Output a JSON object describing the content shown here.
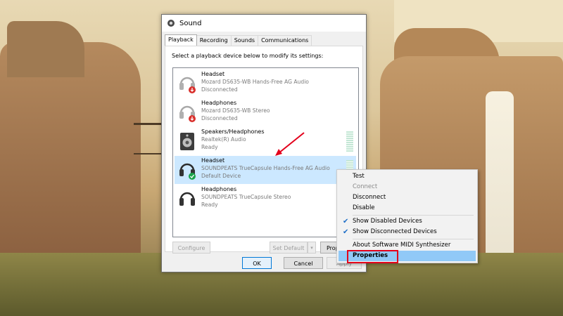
{
  "window": {
    "title": "Sound",
    "tabs": [
      "Playback",
      "Recording",
      "Sounds",
      "Communications"
    ],
    "active_tab": "Playback",
    "instruction": "Select a playback device below to modify its settings:"
  },
  "devices": [
    {
      "name": "Headset",
      "desc": "Mozard DS635-WB Hands-Free AG Audio",
      "status": "Disconnected",
      "icon": "headset-disconnected-icon"
    },
    {
      "name": "Headphones",
      "desc": "Mozard DS635-WB Stereo",
      "status": "Disconnected",
      "icon": "headphones-disconnected-icon"
    },
    {
      "name": "Speakers/Headphones",
      "desc": "Realtek(R) Audio",
      "status": "Ready",
      "icon": "speaker-icon"
    },
    {
      "name": "Headset",
      "desc": "SOUNDPEATS TrueCapsule Hands-Free AG Audio",
      "status": "Default Device",
      "icon": "headset-default-icon"
    },
    {
      "name": "Headphones",
      "desc": "SOUNDPEATS TrueCapsule Stereo",
      "status": "Ready",
      "icon": "headphones-icon"
    }
  ],
  "buttons": {
    "configure": "Configure",
    "set_default": "Set Default",
    "properties": "Prop",
    "ok": "OK",
    "cancel": "Cancel",
    "apply": "Apply"
  },
  "context_menu": {
    "items": [
      {
        "label": "Test",
        "enabled": true
      },
      {
        "label": "Connect",
        "enabled": false
      },
      {
        "label": "Disconnect",
        "enabled": true
      },
      {
        "label": "Disable",
        "enabled": true
      },
      {
        "label": "Show Disabled Devices",
        "checked": true
      },
      {
        "label": "Show Disconnected Devices",
        "checked": true
      },
      {
        "label": "About Software MIDI Synthesizer",
        "enabled": true
      },
      {
        "label": "Properties",
        "enabled": true,
        "highlighted": true
      }
    ]
  },
  "colors": {
    "selection": "#cce8ff",
    "menu_highlight": "#91c9f7",
    "annotation_red": "#e3001b",
    "check_blue": "#1e6fc8"
  }
}
